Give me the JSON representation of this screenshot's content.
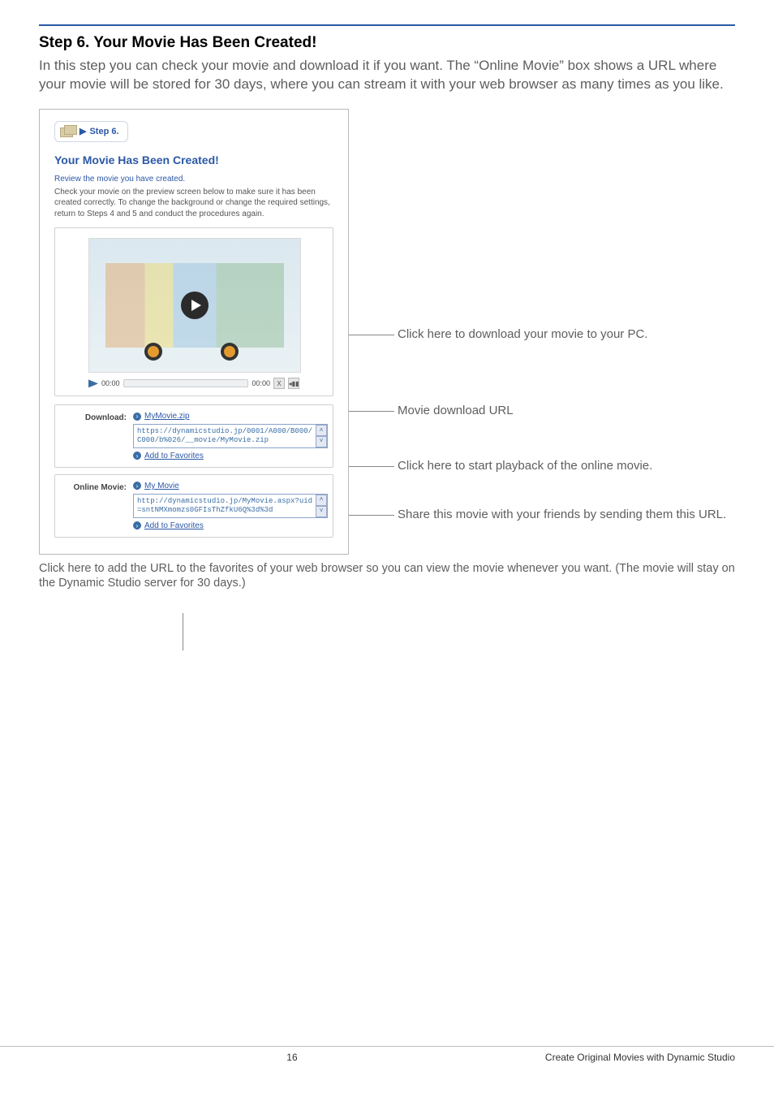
{
  "step": {
    "title_line": "Step 6. Your Movie Has Been Created!",
    "intro": "In this step you can check your movie and download it if you want.\nThe “Online Movie” box shows a URL where your movie will be stored for 30 days, where you can stream it with your web browser as many times as you like."
  },
  "screenshot": {
    "badge": {
      "label": "Step 6."
    },
    "box_title": "Your Movie Has Been Created!",
    "review_note": "Review the movie you have created.",
    "check_note": "Check your movie on the preview screen below to make sure it has been created correctly. To change the background or change the required settings, return to Steps 4 and 5 and conduct the procedures again.",
    "player": {
      "time_start": "00:00",
      "time_end": "00:00",
      "close": "X",
      "vol": "◂▮▮"
    },
    "download": {
      "label": "Download:",
      "file_link": "MyMovie.zip",
      "url": "https://dynamicstudio.jp/0001/A000/B000/C000/b%026/__movie/MyMovie.zip",
      "fav": "Add to Favorites"
    },
    "online": {
      "label": "Online Movie:",
      "file_link": "My Movie",
      "url": "http://dynamicstudio.jp/MyMovie.aspx?uid=sntNMXmomzs0GFIsThZfkU6Q%3d%3d",
      "fav": "Add to Favorites"
    }
  },
  "callouts": {
    "download_pc": "Click here to download your movie to your PC.",
    "download_url": "Movie download URL",
    "play_online": "Click here to start playback of the online movie.",
    "share_url": "Share this movie with your friends by sending them this URL."
  },
  "bottom_note": "Click here to add the URL to the favorites of your web browser so you can view the movie whenever you want. (The movie will stay on the Dynamic Studio server for 30 days.)",
  "footer": {
    "page": "16",
    "book": "Create Original Movies with Dynamic Studio"
  }
}
